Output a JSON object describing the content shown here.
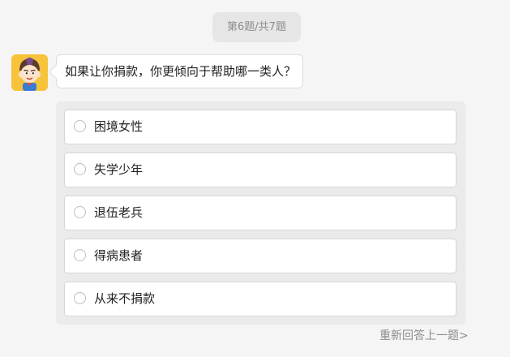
{
  "progress": {
    "label": "第6题/共7题"
  },
  "question": {
    "text": "如果让你捐款，你更倾向于帮助哪一类人？"
  },
  "options": [
    {
      "label": "困境女性"
    },
    {
      "label": "失学少年"
    },
    {
      "label": "退伍老兵"
    },
    {
      "label": "得病患者"
    },
    {
      "label": "从来不捐款"
    }
  ],
  "footer": {
    "prev_label": "重新回答上一题>"
  }
}
